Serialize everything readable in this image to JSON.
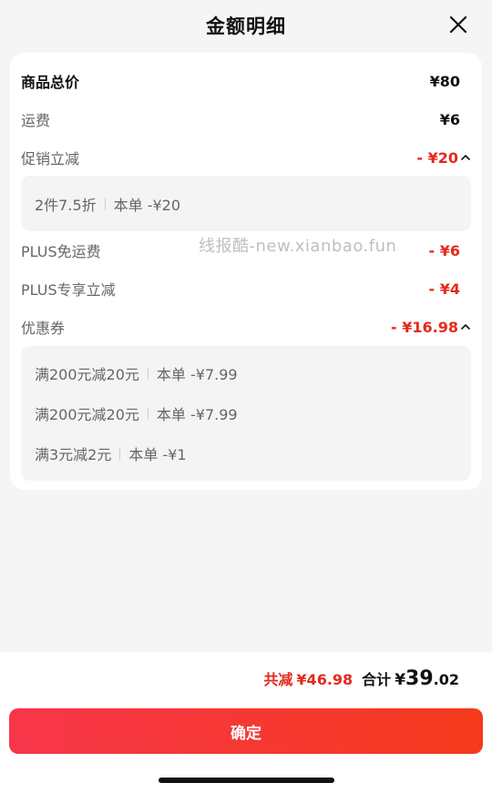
{
  "header": {
    "title": "金额明细"
  },
  "details": [
    {
      "label": "商品总价",
      "value": "¥80"
    },
    {
      "label": "运费",
      "value": "¥6"
    },
    {
      "label": "促销立减",
      "value": "- ¥20"
    },
    {
      "label": "PLUS免运费",
      "value": "- ¥6"
    },
    {
      "label": "PLUS专享立减",
      "value": "- ¥4"
    },
    {
      "label": "优惠券",
      "value": "- ¥16.98"
    }
  ],
  "promotions": [
    {
      "name": "2件7.5折",
      "amount": "本单 -¥20"
    }
  ],
  "coupons": [
    {
      "name": "满200元减20元",
      "amount": "本单 -¥7.99"
    },
    {
      "name": "满200元减20元",
      "amount": "本单 -¥7.99"
    },
    {
      "name": "满3元减2元",
      "amount": "本单 -¥1"
    }
  ],
  "watermark": "线报酷-new.xianbao.fun",
  "footer": {
    "saved_label": "共减",
    "saved_value": "¥46.98",
    "total_label": "合计",
    "currency": "¥",
    "total_int": "39",
    "total_dec": ".02",
    "confirm_label": "确定"
  },
  "colors": {
    "accent_red": "#e5291c",
    "button_start": "#f7364b",
    "button_end": "#f53a1c"
  },
  "icons": {
    "close": "close-icon",
    "collapse": "chevron-up-icon"
  }
}
